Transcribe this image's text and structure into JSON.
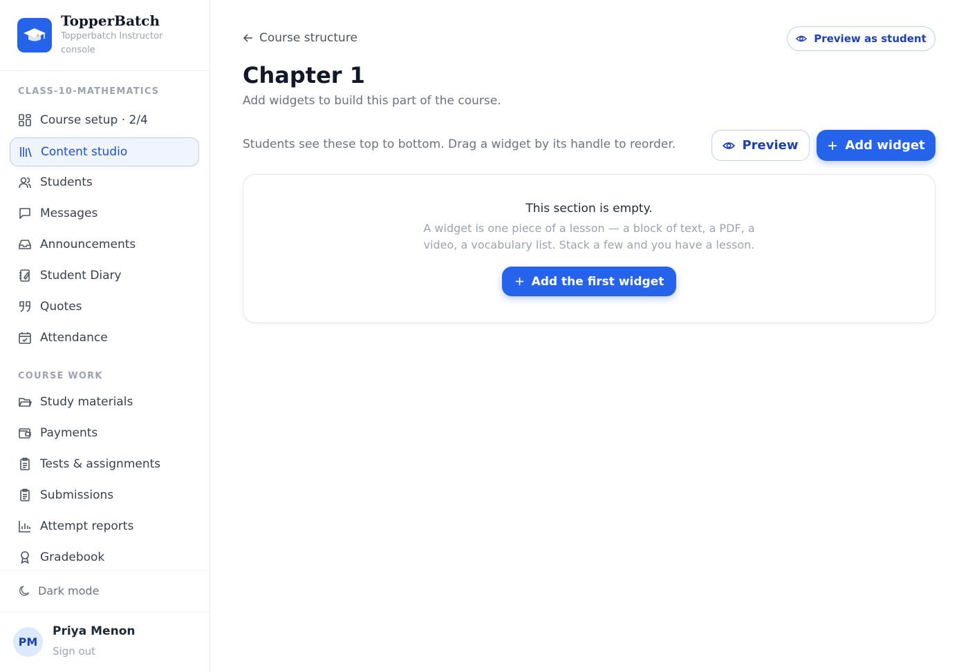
{
  "brand": {
    "name": "TopperBatch",
    "subtitle": "Topperbatch Instructor console"
  },
  "sidebar": {
    "section1_heading": "CLASS-10-MATHEMATICS",
    "section1_items": [
      {
        "label": "Course setup · 2/4",
        "icon": "grid-icon"
      },
      {
        "label": "Content studio",
        "icon": "library-icon",
        "active": true
      },
      {
        "label": "Students",
        "icon": "users-icon"
      },
      {
        "label": "Messages",
        "icon": "message-icon"
      },
      {
        "label": "Announcements",
        "icon": "inbox-icon"
      },
      {
        "label": "Student Diary",
        "icon": "notebook-icon"
      },
      {
        "label": "Quotes",
        "icon": "quote-icon"
      },
      {
        "label": "Attendance",
        "icon": "calendar-check-icon"
      }
    ],
    "section2_heading": "COURSE WORK",
    "section2_items": [
      {
        "label": "Study materials",
        "icon": "folder-icon"
      },
      {
        "label": "Payments",
        "icon": "wallet-icon"
      },
      {
        "label": "Tests & assignments",
        "icon": "clipboard-icon"
      },
      {
        "label": "Submissions",
        "icon": "clipboard-list-icon"
      },
      {
        "label": "Attempt reports",
        "icon": "bar-chart-icon"
      },
      {
        "label": "Gradebook",
        "icon": "award-icon"
      }
    ],
    "dark_mode_label": "Dark mode",
    "user": {
      "initials": "PM",
      "name": "Priya Menon",
      "signout": "Sign out"
    }
  },
  "main": {
    "back_label": "Course structure",
    "preview_student_label": "Preview as student",
    "title": "Chapter 1",
    "subtitle": "Add widgets to build this part of the course.",
    "hint": "Students see these top to bottom. Drag a widget by its handle to reorder.",
    "preview_label": "Preview",
    "add_widget_label": "Add widget",
    "empty": {
      "title": "This section is empty.",
      "description": "A widget is one piece of a lesson — a block of text, a PDF, a video, a vocabulary list. Stack a few and you have a lesson.",
      "button_label": "Add the first widget"
    }
  },
  "colors": {
    "accent": "#2563eb",
    "accent_dark": "#1e40af",
    "active_bg": "#eff4ff"
  }
}
